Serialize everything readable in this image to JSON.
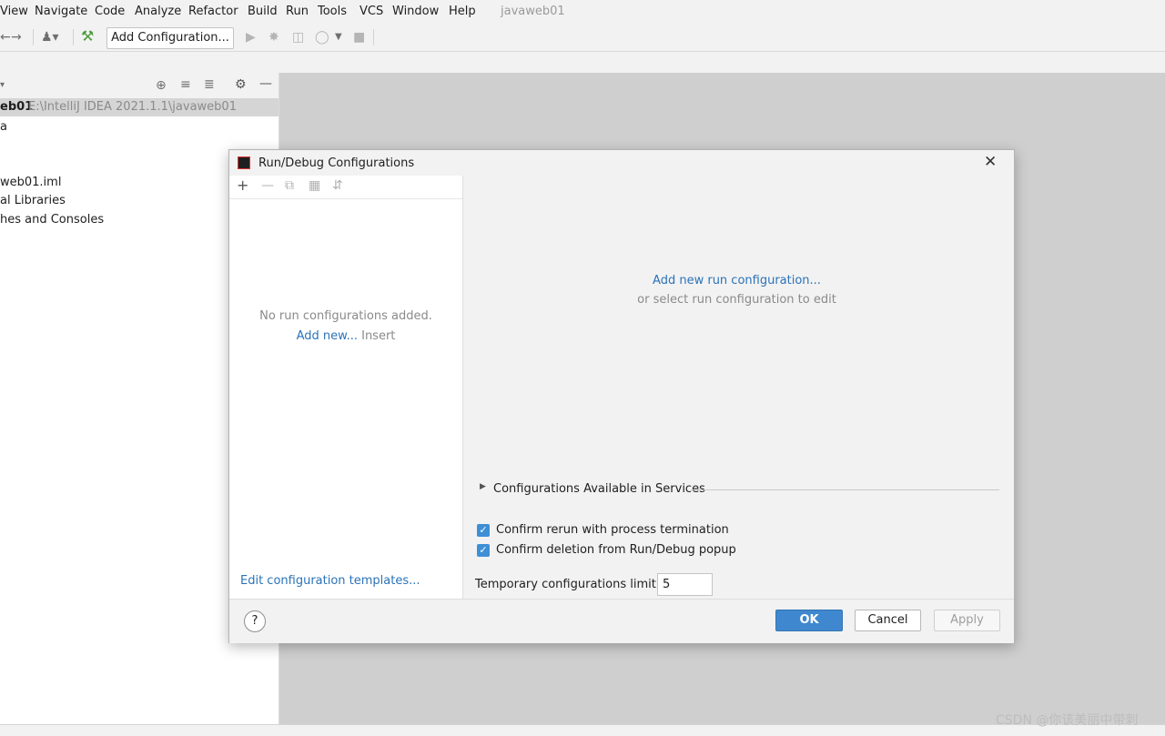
{
  "menu": {
    "items": [
      "View",
      "Navigate",
      "Code",
      "Analyze",
      "Refactor",
      "Build",
      "Run",
      "Tools",
      "VCS",
      "Window",
      "Help"
    ],
    "project_name": "javaweb01"
  },
  "toolbar": {
    "add_configuration": "Add Configuration..."
  },
  "project_panel": {
    "root_name": "eb01",
    "root_path": "E:\\IntelliJ IDEA 2021.1.1\\javaweb01",
    "tree_items": [
      "a",
      "",
      "web01.iml",
      "al Libraries",
      "hes and Consoles"
    ]
  },
  "dialog": {
    "title": "Run/Debug Configurations",
    "empty_message": "No run configurations added.",
    "add_new_link": "Add new...",
    "insert_hint": "Insert",
    "edit_templates_link": "Edit configuration templates...",
    "add_run_config_link": "Add new run configuration...",
    "select_hint": "or select run configuration to edit",
    "services_section": "Configurations Available in Services",
    "confirm_rerun": "Confirm rerun with process termination",
    "confirm_deletion": "Confirm deletion from Run/Debug popup",
    "temp_limit_label": "Temporary configurations limit:",
    "temp_limit_value": "5",
    "help_label": "?",
    "ok_label": "OK",
    "cancel_label": "Cancel",
    "apply_label": "Apply",
    "close_icon": "close-icon"
  },
  "watermark": "CSDN @你该美丽中带刺",
  "colors": {
    "accent": "#3f88cf",
    "link": "#2a73b8",
    "editor_bg": "#cfcfcf"
  }
}
